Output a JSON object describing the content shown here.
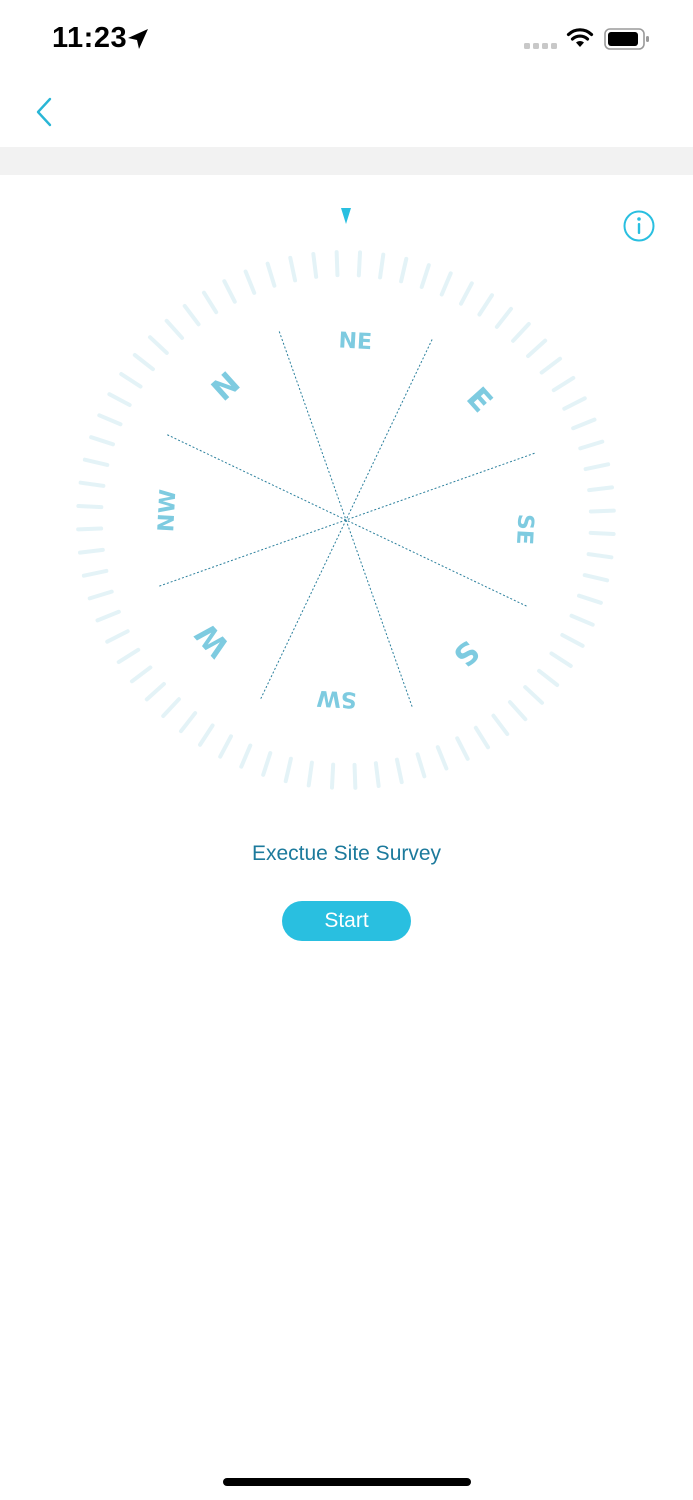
{
  "status_bar": {
    "time": "11:23",
    "icons": [
      "location-arrow-icon",
      "cellular-signal-icon",
      "wifi-icon",
      "battery-icon"
    ]
  },
  "nav": {
    "back_icon": "chevron-left-icon"
  },
  "compass": {
    "info_icon": "info-icon",
    "heading_marker_icon": "heading-triangle-icon",
    "labels": {
      "n": "N",
      "ne": "NE",
      "e": "E",
      "se": "SE",
      "s": "S",
      "sw": "SW",
      "w": "W",
      "nw": "NW"
    },
    "rotation_degrees": -42
  },
  "survey": {
    "title": "Exectue Site Survey",
    "start_label": "Start"
  },
  "colors": {
    "accent": "#29bfe0",
    "label": "#7ecbe0",
    "title_text": "#1c7a9c",
    "tick": "#e4f3f7",
    "line": "#2a7f9c"
  }
}
